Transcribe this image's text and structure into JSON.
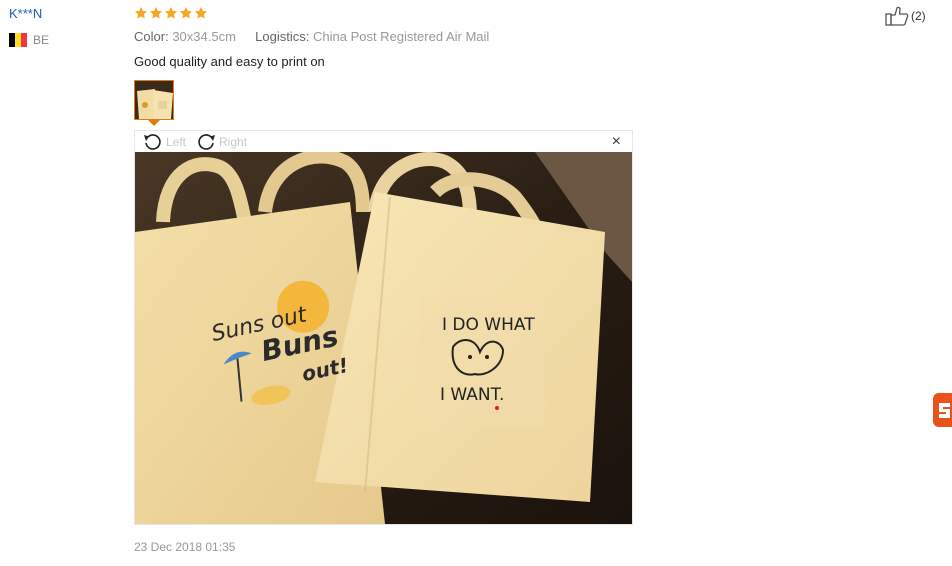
{
  "reviewer": {
    "name": "K***N",
    "country_code": "BE",
    "flag_colors": [
      "#000000",
      "#FDDA24",
      "#EF3340"
    ]
  },
  "rating": {
    "stars": 5,
    "max": 5,
    "color": "#f5a623"
  },
  "meta": {
    "color_label": "Color:",
    "color_value": "30x34.5cm",
    "logistics_label": "Logistics:",
    "logistics_value": "China Post Registered Air Mail"
  },
  "review_text": "Good quality and easy to print on",
  "helpful": {
    "count_text": "(2)"
  },
  "viewer": {
    "rotate_left_label": "Left",
    "rotate_right_label": "Right",
    "close_glyph": "×"
  },
  "photo": {
    "left_bag": {
      "line1": "Suns out",
      "line2": "Buns",
      "line3": "out!"
    },
    "right_bag": {
      "line1": "I DO WHAT",
      "line2": "I WANT."
    }
  },
  "date": "23 Dec 2018 01:35",
  "accent_color": "#e07a14"
}
